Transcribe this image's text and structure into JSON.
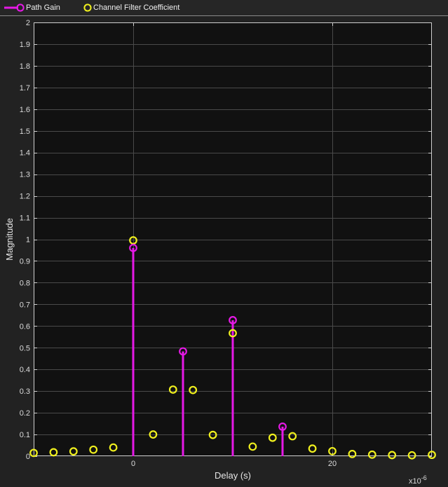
{
  "chart_data": {
    "type": "stem",
    "xlabel": "Delay (s)",
    "ylabel": "Magnitude",
    "x_exponent_base": "x10",
    "x_exponent_power": "-6",
    "xlim": [
      -10,
      30
    ],
    "ylim": [
      0,
      2
    ],
    "x_ticks": [
      0,
      20
    ],
    "y_ticks": [
      0,
      0.1,
      0.2,
      0.3,
      0.4,
      0.5,
      0.6,
      0.7,
      0.8,
      0.9,
      1,
      1.1,
      1.2,
      1.3,
      1.4,
      1.5,
      1.6,
      1.7,
      1.8,
      1.9,
      2
    ],
    "grid": true,
    "legend_position": "top",
    "series": [
      {
        "name": "Path Gain",
        "color": "#e619e6",
        "marker": "circle-stem",
        "x": [
          0,
          5,
          10,
          15
        ],
        "y": [
          0.96,
          0.483,
          0.627,
          0.136
        ]
      },
      {
        "name": "Channel Filter Coefficient",
        "color": "#f0f01e",
        "marker": "circle",
        "x": [
          -10,
          -8,
          -6,
          -4,
          -2,
          2,
          4,
          6,
          8,
          10,
          12,
          14,
          16,
          18,
          20,
          22,
          24,
          26,
          28,
          30,
          0
        ],
        "y": [
          0.015,
          0.018,
          0.022,
          0.03,
          0.04,
          0.1,
          0.307,
          0.305,
          0.098,
          0.567,
          0.044,
          0.085,
          0.092,
          0.035,
          0.023,
          0.01,
          0.007,
          0.005,
          0.004,
          0.006,
          0.995
        ]
      }
    ]
  }
}
